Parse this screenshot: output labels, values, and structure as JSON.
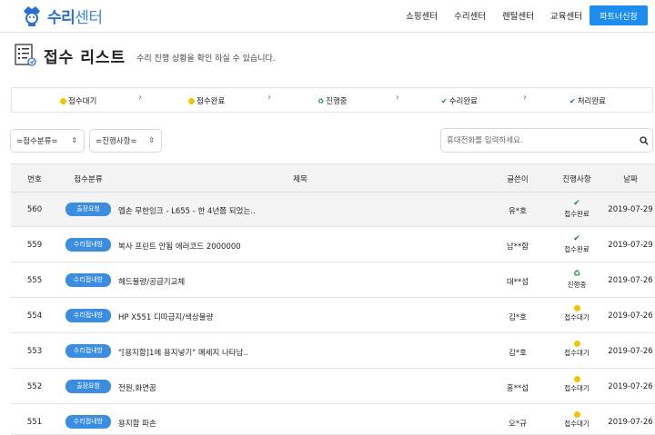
{
  "header": {
    "logo": {
      "text_bold": "수리",
      "text_light": "센터",
      "icon": "repair-mascot-icon"
    },
    "nav": [
      "쇼핑센터",
      "수리센터",
      "렌탈센터",
      "교육센터"
    ],
    "partner_button": "파트너신청"
  },
  "page": {
    "title": "접수 리스트",
    "subtitle": "수리 진행 상황을 확인 하실 수 있습니다.",
    "title_icon": "list-document-icon"
  },
  "steps": [
    {
      "label": "접수대기",
      "icon": "yellow-dot"
    },
    {
      "label": "접수완료",
      "icon": "yellow-dot"
    },
    {
      "label": "진행중",
      "icon": "recycle-icon"
    },
    {
      "label": "수리완료",
      "icon": "check-circle-icon"
    },
    {
      "label": "처리완료",
      "icon": "check-circle-blue-icon"
    }
  ],
  "filters": {
    "category": "=접수분류=",
    "status": "=진행사항=",
    "search_placeholder": "휴대전화를 입력하세요."
  },
  "table": {
    "columns": [
      "번호",
      "접수분류",
      "제목",
      "글쓴이",
      "진행사항",
      "날짜"
    ],
    "rows": [
      {
        "num": "560",
        "category": "출장요청",
        "title": "엡손 무한잉크 - L655 - 한 4년쯤 되었는..",
        "author": "유*호",
        "status": "접수완료",
        "status_icon": "check",
        "date": "2019-07-29"
      },
      {
        "num": "559",
        "category": "수리접내방",
        "title": "복사 프린트 안됨 에러코드 2000000",
        "author": "남**함",
        "status": "접수완료",
        "status_icon": "check",
        "date": "2019-07-29"
      },
      {
        "num": "555",
        "category": "수리접내방",
        "title": "헤드불량/공급기교체",
        "author": "대**섬",
        "status": "진행중",
        "status_icon": "recycle",
        "date": "2019-07-26"
      },
      {
        "num": "554",
        "category": "수리접내방",
        "title": "HP X551 디따금지/색상불량",
        "author": "김*호",
        "status": "접수대기",
        "status_icon": "dot",
        "date": "2019-07-26"
      },
      {
        "num": "553",
        "category": "수리접내방",
        "title": "\"[용지함]1에 용지넣기\" 메세지 나타남..",
        "author": "김*호",
        "status": "접수대기",
        "status_icon": "dot",
        "date": "2019-07-26"
      },
      {
        "num": "552",
        "category": "출장요청",
        "title": "전원,화면꿈",
        "author": "홍**섭",
        "status": "접수대기",
        "status_icon": "dot",
        "date": "2019-07-26"
      },
      {
        "num": "551",
        "category": "수리접내방",
        "title": "용지함 파손",
        "author": "오*규",
        "status": "접수대기",
        "status_icon": "dot",
        "date": "2019-07-26"
      }
    ]
  },
  "colors": {
    "accent_blue": "#1e8df0",
    "badge_blue": "#3b8de0",
    "waiting_yellow": "#f5c400",
    "complete_green": "#1a8a3a"
  }
}
